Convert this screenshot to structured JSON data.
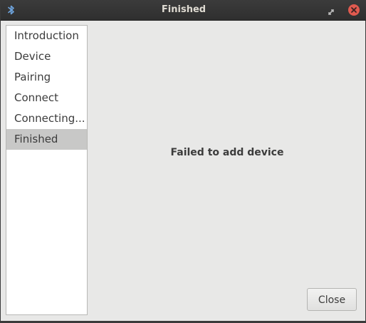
{
  "window": {
    "title": "Finished"
  },
  "sidebar": {
    "items": [
      {
        "label": "Introduction"
      },
      {
        "label": "Device"
      },
      {
        "label": "Pairing"
      },
      {
        "label": "Connect"
      },
      {
        "label": "Connecting..."
      },
      {
        "label": "Finished"
      }
    ],
    "selected_index": 5
  },
  "main": {
    "message": "Failed to add device",
    "close_label": "Close"
  },
  "icons": {
    "app": "bluetooth-icon",
    "restore": "restore-icon",
    "close": "close-icon"
  },
  "colors": {
    "titlebar": "#333333",
    "close_button": "#e05a4f",
    "selected_row": "#c8c8c7"
  }
}
